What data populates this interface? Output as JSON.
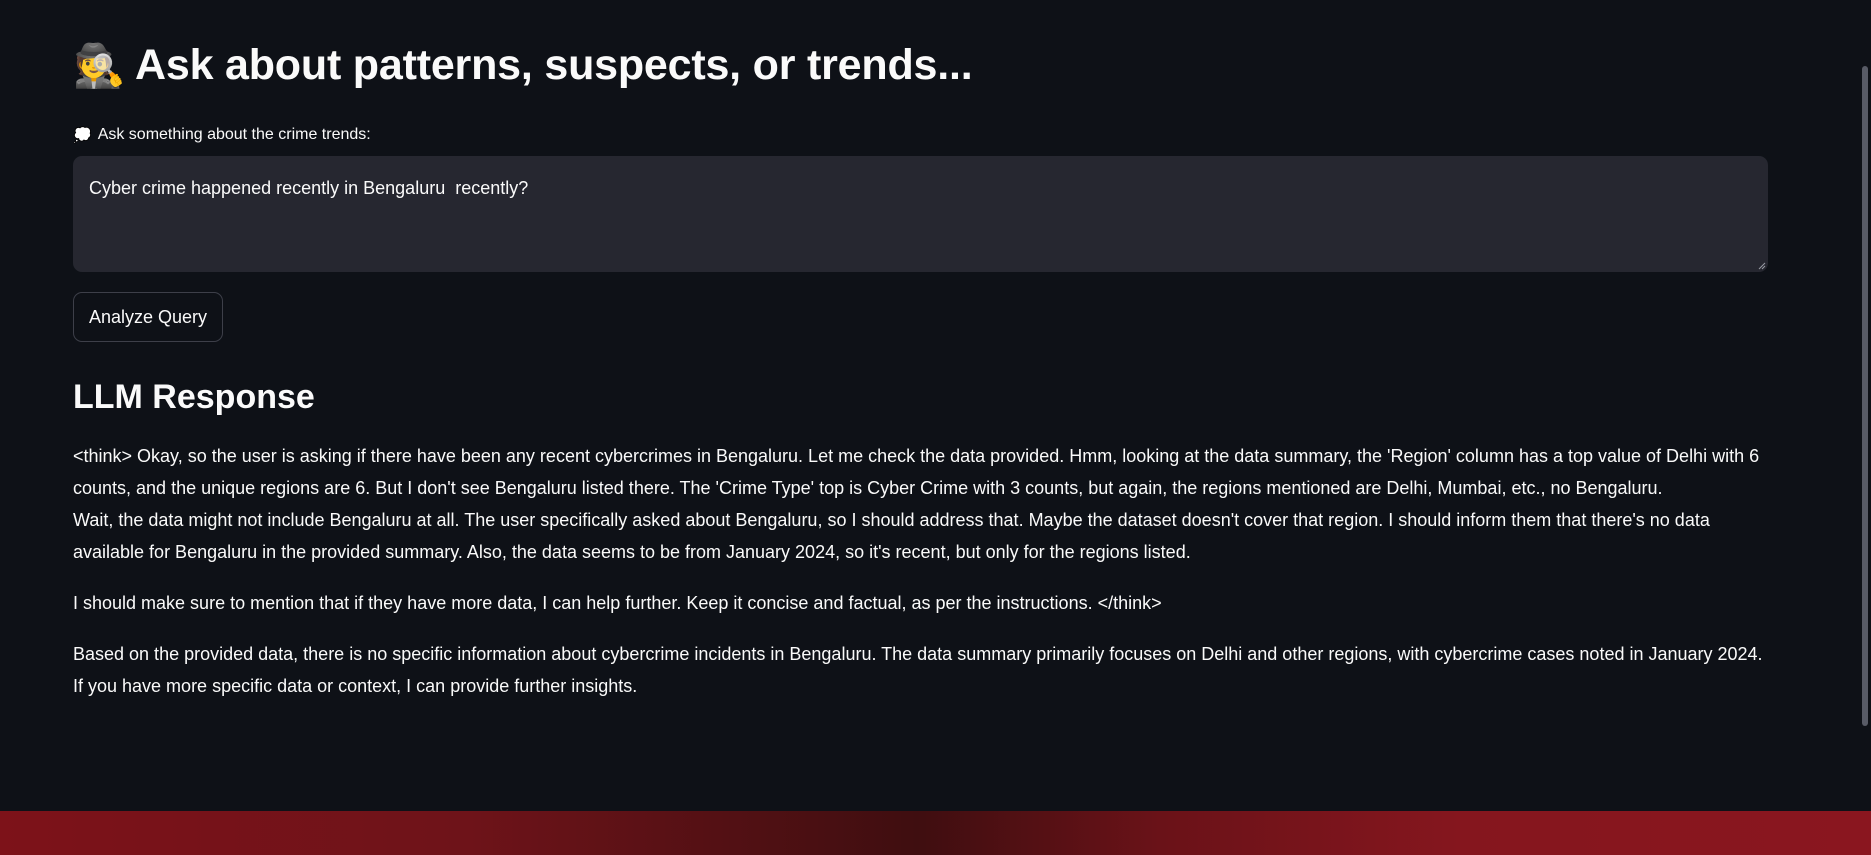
{
  "header": {
    "icon": "detective-emoji",
    "emoji": "🕵️",
    "title": "Ask about patterns, suspects, or trends..."
  },
  "query": {
    "label_icon": "thought-bubble-emoji",
    "label_emoji": "💭",
    "label": "Ask something about the crime trends:",
    "value": "Cyber crime happened recently in Bengaluru  recently?"
  },
  "actions": {
    "analyze_label": "Analyze Query"
  },
  "response": {
    "heading": "LLM Response",
    "paragraph1_line1": "<think> Okay, so the user is asking if there have been any recent cybercrimes in Bengaluru. Let me check the data provided. Hmm, looking at the data summary, the 'Region' column has a top value of Delhi with 6 counts, and the unique regions are 6. But I don't see Bengaluru listed there. The 'Crime Type' top is Cyber Crime with 3 counts, but again, the regions mentioned are Delhi, Mumbai, etc., no Bengaluru.",
    "paragraph1_line2": "Wait, the data might not include Bengaluru at all. The user specifically asked about Bengaluru, so I should address that. Maybe the dataset doesn't cover that region. I should inform them that there's no data available for Bengaluru in the provided summary. Also, the data seems to be from January 2024, so it's recent, but only for the regions listed.",
    "paragraph2": "I should make sure to mention that if they have more data, I can help further. Keep it concise and factual, as per the instructions. </think>",
    "paragraph3": "Based on the provided data, there is no specific information about cybercrime incidents in Bengaluru. The data summary primarily focuses on Delhi and other regions, with cybercrime cases noted in January 2024. If you have more specific data or context, I can provide further insights."
  },
  "colors": {
    "background": "#0e1117",
    "input_background": "#262730",
    "text": "#fafafa",
    "footer_red": "#8a161f"
  }
}
